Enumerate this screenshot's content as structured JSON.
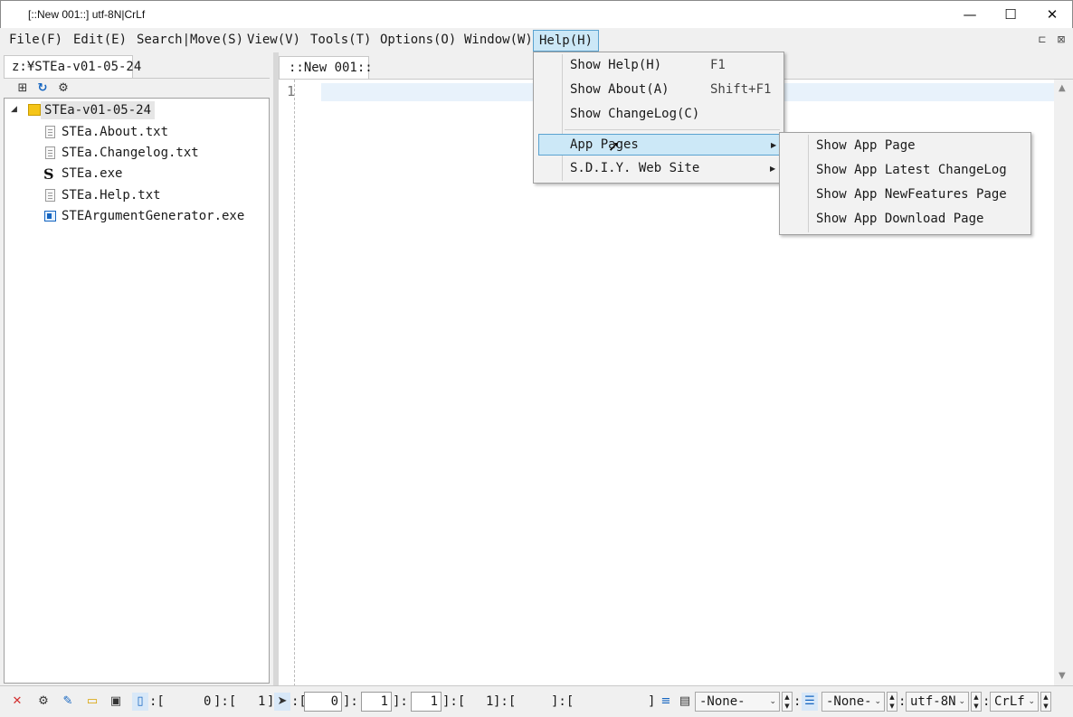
{
  "window": {
    "title": "[::New 001::]  utf-8N|CrLf",
    "minimize": "—",
    "maximize": "☐",
    "close": "✕"
  },
  "menubar": {
    "items": [
      "File(F)",
      "Edit(E)",
      "Search|Move(S)",
      "View(V)",
      "Tools(T)",
      "Options(O)",
      "Window(W)",
      "Help(H)"
    ],
    "active": "Help(H)"
  },
  "leftpanel": {
    "tab": "z:¥STEa-v01-05-24",
    "root": "STEa-v01-05-24",
    "files": [
      "STEa.About.txt",
      "STEa.Changelog.txt",
      "STEa.exe",
      "STEa.Help.txt",
      "STEArgumentGenerator.exe"
    ]
  },
  "editor": {
    "tab": "::New 001::",
    "line_number": "1"
  },
  "help_menu": {
    "items": [
      {
        "label": "Show Help(H)",
        "shortcut": "F1"
      },
      {
        "label": "Show About(A)",
        "shortcut": "Shift+F1"
      },
      {
        "label": "Show ChangeLog(C)",
        "shortcut": ""
      },
      {
        "label": "App Pages",
        "shortcut": ""
      },
      {
        "label": "S.D.I.Y. Web Site",
        "shortcut": ""
      }
    ],
    "highlighted": "App Pages"
  },
  "app_pages_submenu": {
    "items": [
      "Show App Page",
      "Show App Latest ChangeLog",
      "Show App NewFeatures Page",
      "Show App Download Page"
    ]
  },
  "statusbar": {
    "pos1_prefix": ":[",
    "pos1_a": "0",
    "pos1_mid": "]:[",
    "pos1_b": "1",
    "pos1_end": "]",
    "sel_prefix": ":[",
    "sel_a": "0",
    "sel_b": "1",
    "sel_c": "1",
    "sel_d": "1",
    "sel_end": "]:[",
    "sel_tail": "]:[",
    "sel_close": "]",
    "sep": "]:[",
    "colon": ":",
    "none1": "-None-",
    "none2": "-None-",
    "encoding": "utf-8N",
    "eol": "CrLf"
  }
}
